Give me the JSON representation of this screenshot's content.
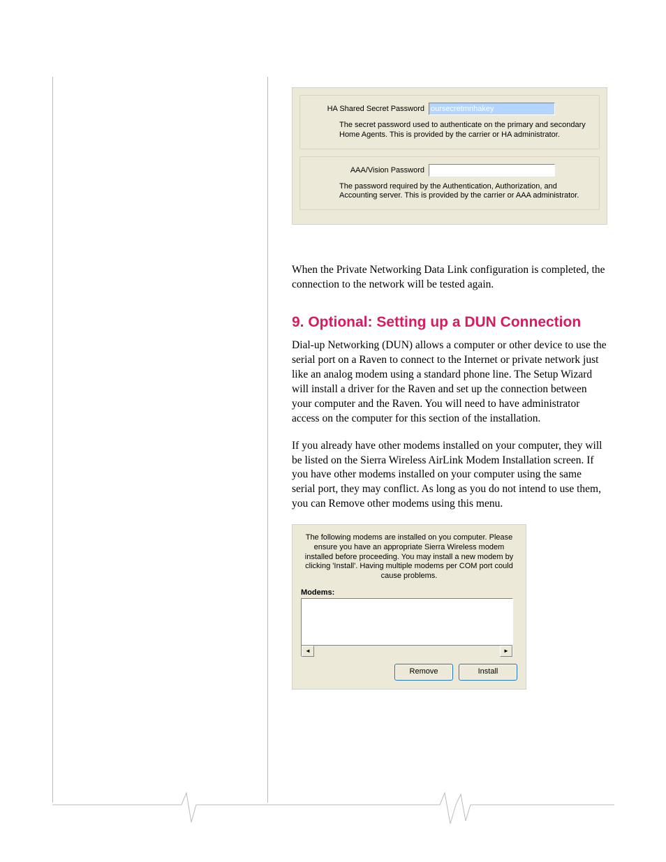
{
  "dialog1": {
    "group1": {
      "label": "HA Shared Secret Password",
      "value": "oursecretmnhakey",
      "desc": "The secret password used to authenticate on the primary and secondary Home Agents. This is provided by the carrier or HA administrator."
    },
    "group2": {
      "label": "AAA/Vision Password",
      "value": "",
      "desc": "The password required by the Authentication, Authorization, and Accounting server. This is provided by the carrier or AAA administrator."
    }
  },
  "paragraphs": {
    "after_dialog": "When the Private Networking Data Link configuration is completed, the connection to the network will be tested again.",
    "section_title": "9. Optional: Setting up a DUN Connection",
    "p1": "Dial-up Networking (DUN) allows a computer or other device to use the serial port on a Raven to connect to the Internet or private network just like an analog modem using a standard phone line. The Setup Wizard will install a driver for the Raven and set up the connection between your computer and the Raven. You will need to have administrator access on the computer for this section of the installation.",
    "p2": "If you already have other modems installed on your computer, they will be listed on the Sierra Wireless AirLink Modem Installation screen. If you have other modems installed on your computer using the same serial port, they may conflict. As long as you do not intend to use them, you can Remove other modems using this menu."
  },
  "modem_panel": {
    "intro": "The following modems are installed on you computer. Please ensure you have an appropriate Sierra Wireless modem installed before proceeding. You may install a new modem by clicking 'Install'. Having multiple modems per COM port could cause problems.",
    "label": "Modems:",
    "remove": "Remove",
    "install": "Install"
  }
}
